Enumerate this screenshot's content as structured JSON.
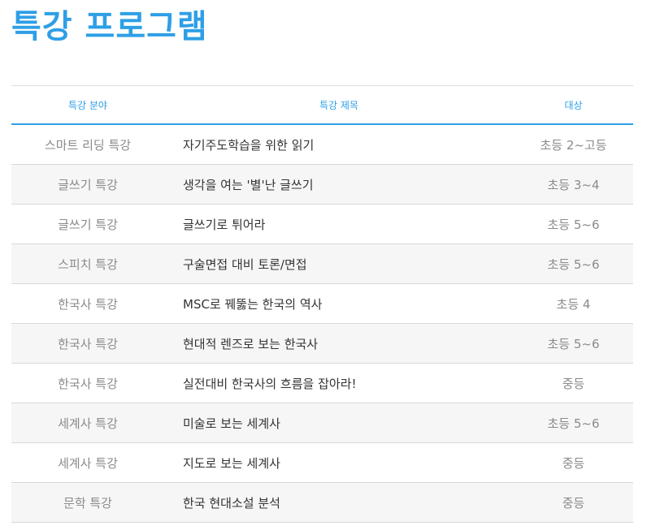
{
  "page": {
    "title": "특강 프로그램"
  },
  "table": {
    "headers": {
      "field": "특강 분야",
      "title": "특강 제목",
      "target": "대상"
    },
    "rows": [
      {
        "field": "스마트 리딩 특강",
        "title": "자기주도학습을 위한 읽기",
        "target": "초등 2~고등"
      },
      {
        "field": "글쓰기 특강",
        "title": "생각을 여는 '별'난 글쓰기",
        "target": "초등 3~4"
      },
      {
        "field": "글쓰기 특강",
        "title": "글쓰기로 튀어라",
        "target": "초등 5~6"
      },
      {
        "field": "스피치 특강",
        "title": "구술면접 대비 토론/면접",
        "target": "초등 5~6"
      },
      {
        "field": "한국사 특강",
        "title": "MSC로 꿰뚫는 한국의 역사",
        "target": "초등 4"
      },
      {
        "field": "한국사 특강",
        "title": "현대적 렌즈로 보는 한국사",
        "target": "초등 5~6"
      },
      {
        "field": "한국사 특강",
        "title": "실전대비 한국사의 흐름을 잡아라!",
        "target": "중등"
      },
      {
        "field": "세계사 특강",
        "title": "미술로 보는 세계사",
        "target": "초등 5~6"
      },
      {
        "field": "세계사 특강",
        "title": "지도로 보는 세계사",
        "target": "중등"
      },
      {
        "field": "문학 특강",
        "title": "한국 현대소설 분석",
        "target": "중등"
      }
    ]
  },
  "colors": {
    "accent": "#2e9fe6",
    "muted_text": "#8a8a8a",
    "body_text": "#333333",
    "stripe": "#f6f6f6"
  }
}
